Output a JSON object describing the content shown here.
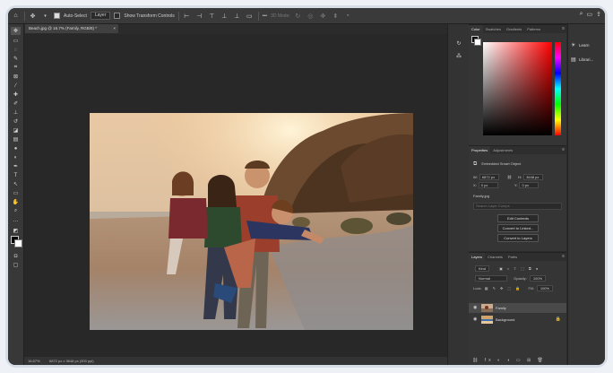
{
  "options_bar": {
    "home_icon": "home-icon",
    "move_icon": "move-icon",
    "auto_select_label": "Auto-Select",
    "auto_select_value": "Layer",
    "show_transform_label": "Show Transform Controls",
    "more_label": "•••",
    "mode_3d": "3D Mode:"
  },
  "document_tab": {
    "title": "Beach.jpg @ 16.7% (Family, RGB/8) *",
    "close": "×"
  },
  "color_panel": {
    "tabs": [
      "Color",
      "Swatches",
      "Gradients",
      "Patterns"
    ],
    "active_tab": "Color",
    "foreground": "#000000",
    "background": "#ffffff"
  },
  "properties_panel": {
    "tabs": [
      "Properties",
      "Adjustments"
    ],
    "object_type": "Embedded Smart Object",
    "W_label": "W:",
    "W_value": "6872 px",
    "H_label": "H:",
    "H_value": "3648 px",
    "X_label": "X:",
    "X_value": "0 px",
    "Y_label": "Y:",
    "Y_value": "0 px",
    "filename": "Family.jpg",
    "search_placeholder": "Search Layer Comps",
    "buttons": [
      "Edit Contents",
      "Convert to Linked...",
      "Convert to Layers"
    ]
  },
  "layers_panel": {
    "tabs": [
      "Layers",
      "Channels",
      "Paths"
    ],
    "kind_label": "Kind",
    "blend_mode": "Normal",
    "opacity_label": "Opacity:",
    "opacity_value": "100%",
    "lock_label": "Lock:",
    "fill_label": "Fill:",
    "fill_value": "100%",
    "layers": [
      {
        "name": "Family",
        "selected": true
      },
      {
        "name": "Background",
        "selected": false,
        "locked": true
      }
    ],
    "footer_icons": "⛓ fx ◐ ◑ ▭ ⊞ 🗑"
  },
  "status_bar": {
    "zoom": "16.67%",
    "doc_info": "6872 px x 3648 px (300 ppi)"
  },
  "learn_panel": {
    "items": [
      "Learn",
      "Librari..."
    ]
  }
}
